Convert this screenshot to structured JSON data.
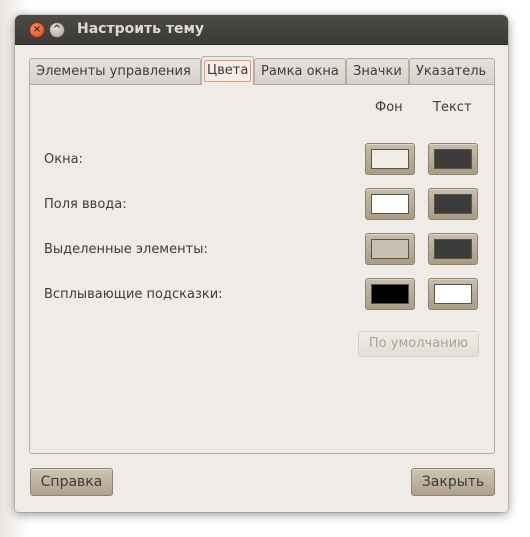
{
  "window": {
    "title": "Настроить тему"
  },
  "tabs": [
    {
      "label": "Элементы управления",
      "active": false
    },
    {
      "label": "Цвета",
      "active": true
    },
    {
      "label": "Рамка окна",
      "active": false
    },
    {
      "label": "Значки",
      "active": false
    },
    {
      "label": "Указатель",
      "active": false
    }
  ],
  "colors_panel": {
    "header_bg": "Фон",
    "header_text": "Текст",
    "rows": [
      {
        "label": "Окна:",
        "bg_color": "#efebe7",
        "text_color": "#3c3c3c"
      },
      {
        "label": "Поля ввода:",
        "bg_color": "#ffffff",
        "text_color": "#3c3c3c"
      },
      {
        "label": "Выделенные элементы:",
        "bg_color": "#c9bfb2",
        "text_color": "#3c3c3c"
      },
      {
        "label": "Всплывающие подсказки:",
        "bg_color": "#000000",
        "text_color": "#ffffff"
      }
    ],
    "default_button": "По умолчанию"
  },
  "footer": {
    "help_button": "Справка",
    "close_button": "Закрыть"
  }
}
